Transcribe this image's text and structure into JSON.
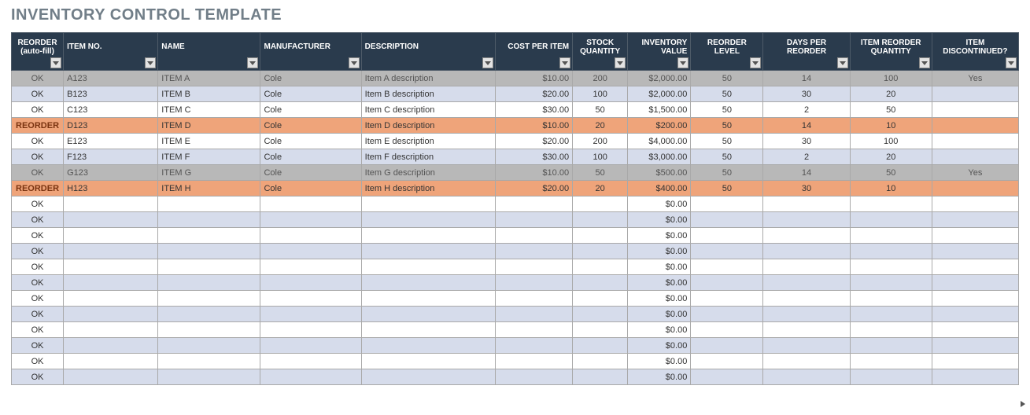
{
  "title": "INVENTORY CONTROL TEMPLATE",
  "columns": [
    {
      "key": "reorder",
      "label": "REORDER (auto-fill)"
    },
    {
      "key": "item_no",
      "label": "ITEM NO."
    },
    {
      "key": "name",
      "label": "NAME"
    },
    {
      "key": "mfr",
      "label": "MANUFACTURER"
    },
    {
      "key": "desc",
      "label": "DESCRIPTION"
    },
    {
      "key": "cost",
      "label": "COST PER ITEM"
    },
    {
      "key": "stock",
      "label": "STOCK QUANTITY"
    },
    {
      "key": "value",
      "label": "INVENTORY VALUE"
    },
    {
      "key": "level",
      "label": "REORDER LEVEL"
    },
    {
      "key": "days",
      "label": "DAYS PER REORDER"
    },
    {
      "key": "rqty",
      "label": "ITEM REORDER QUANTITY"
    },
    {
      "key": "disc",
      "label": "ITEM DISCONTINUED?"
    }
  ],
  "rows": [
    {
      "state": "grey",
      "reorder": "OK",
      "item_no": "A123",
      "name": "ITEM A",
      "mfr": "Cole",
      "desc": "Item A description",
      "cost": "$10.00",
      "stock": "200",
      "value": "$2,000.00",
      "level": "50",
      "days": "14",
      "rqty": "100",
      "disc": "Yes"
    },
    {
      "state": "blue",
      "reorder": "OK",
      "item_no": "B123",
      "name": "ITEM B",
      "mfr": "Cole",
      "desc": "Item B description",
      "cost": "$20.00",
      "stock": "100",
      "value": "$2,000.00",
      "level": "50",
      "days": "30",
      "rqty": "20",
      "disc": ""
    },
    {
      "state": "white",
      "reorder": "OK",
      "item_no": "C123",
      "name": "ITEM C",
      "mfr": "Cole",
      "desc": "Item C description",
      "cost": "$30.00",
      "stock": "50",
      "value": "$1,500.00",
      "level": "50",
      "days": "2",
      "rqty": "50",
      "disc": ""
    },
    {
      "state": "orange",
      "reorder": "REORDER",
      "item_no": "D123",
      "name": "ITEM D",
      "mfr": "Cole",
      "desc": "Item D description",
      "cost": "$10.00",
      "stock": "20",
      "value": "$200.00",
      "level": "50",
      "days": "14",
      "rqty": "10",
      "disc": ""
    },
    {
      "state": "white",
      "reorder": "OK",
      "item_no": "E123",
      "name": "ITEM E",
      "mfr": "Cole",
      "desc": "Item E description",
      "cost": "$20.00",
      "stock": "200",
      "value": "$4,000.00",
      "level": "50",
      "days": "30",
      "rqty": "100",
      "disc": ""
    },
    {
      "state": "blue",
      "reorder": "OK",
      "item_no": "F123",
      "name": "ITEM F",
      "mfr": "Cole",
      "desc": "Item F description",
      "cost": "$30.00",
      "stock": "100",
      "value": "$3,000.00",
      "level": "50",
      "days": "2",
      "rqty": "20",
      "disc": ""
    },
    {
      "state": "grey",
      "reorder": "OK",
      "item_no": "G123",
      "name": "ITEM G",
      "mfr": "Cole",
      "desc": "Item G description",
      "cost": "$10.00",
      "stock": "50",
      "value": "$500.00",
      "level": "50",
      "days": "14",
      "rqty": "50",
      "disc": "Yes"
    },
    {
      "state": "orange",
      "reorder": "REORDER",
      "item_no": "H123",
      "name": "ITEM H",
      "mfr": "Cole",
      "desc": "Item H description",
      "cost": "$20.00",
      "stock": "20",
      "value": "$400.00",
      "level": "50",
      "days": "30",
      "rqty": "10",
      "disc": ""
    },
    {
      "state": "white",
      "reorder": "OK",
      "item_no": "",
      "name": "",
      "mfr": "",
      "desc": "",
      "cost": "",
      "stock": "",
      "value": "$0.00",
      "level": "",
      "days": "",
      "rqty": "",
      "disc": ""
    },
    {
      "state": "blue",
      "reorder": "OK",
      "item_no": "",
      "name": "",
      "mfr": "",
      "desc": "",
      "cost": "",
      "stock": "",
      "value": "$0.00",
      "level": "",
      "days": "",
      "rqty": "",
      "disc": ""
    },
    {
      "state": "white",
      "reorder": "OK",
      "item_no": "",
      "name": "",
      "mfr": "",
      "desc": "",
      "cost": "",
      "stock": "",
      "value": "$0.00",
      "level": "",
      "days": "",
      "rqty": "",
      "disc": ""
    },
    {
      "state": "blue",
      "reorder": "OK",
      "item_no": "",
      "name": "",
      "mfr": "",
      "desc": "",
      "cost": "",
      "stock": "",
      "value": "$0.00",
      "level": "",
      "days": "",
      "rqty": "",
      "disc": ""
    },
    {
      "state": "white",
      "reorder": "OK",
      "item_no": "",
      "name": "",
      "mfr": "",
      "desc": "",
      "cost": "",
      "stock": "",
      "value": "$0.00",
      "level": "",
      "days": "",
      "rqty": "",
      "disc": ""
    },
    {
      "state": "blue",
      "reorder": "OK",
      "item_no": "",
      "name": "",
      "mfr": "",
      "desc": "",
      "cost": "",
      "stock": "",
      "value": "$0.00",
      "level": "",
      "days": "",
      "rqty": "",
      "disc": ""
    },
    {
      "state": "white",
      "reorder": "OK",
      "item_no": "",
      "name": "",
      "mfr": "",
      "desc": "",
      "cost": "",
      "stock": "",
      "value": "$0.00",
      "level": "",
      "days": "",
      "rqty": "",
      "disc": ""
    },
    {
      "state": "blue",
      "reorder": "OK",
      "item_no": "",
      "name": "",
      "mfr": "",
      "desc": "",
      "cost": "",
      "stock": "",
      "value": "$0.00",
      "level": "",
      "days": "",
      "rqty": "",
      "disc": ""
    },
    {
      "state": "white",
      "reorder": "OK",
      "item_no": "",
      "name": "",
      "mfr": "",
      "desc": "",
      "cost": "",
      "stock": "",
      "value": "$0.00",
      "level": "",
      "days": "",
      "rqty": "",
      "disc": ""
    },
    {
      "state": "blue",
      "reorder": "OK",
      "item_no": "",
      "name": "",
      "mfr": "",
      "desc": "",
      "cost": "",
      "stock": "",
      "value": "$0.00",
      "level": "",
      "days": "",
      "rqty": "",
      "disc": ""
    },
    {
      "state": "white",
      "reorder": "OK",
      "item_no": "",
      "name": "",
      "mfr": "",
      "desc": "",
      "cost": "",
      "stock": "",
      "value": "$0.00",
      "level": "",
      "days": "",
      "rqty": "",
      "disc": ""
    },
    {
      "state": "blue",
      "reorder": "OK",
      "item_no": "",
      "name": "",
      "mfr": "",
      "desc": "",
      "cost": "",
      "stock": "",
      "value": "$0.00",
      "level": "",
      "days": "",
      "rqty": "",
      "disc": ""
    }
  ]
}
